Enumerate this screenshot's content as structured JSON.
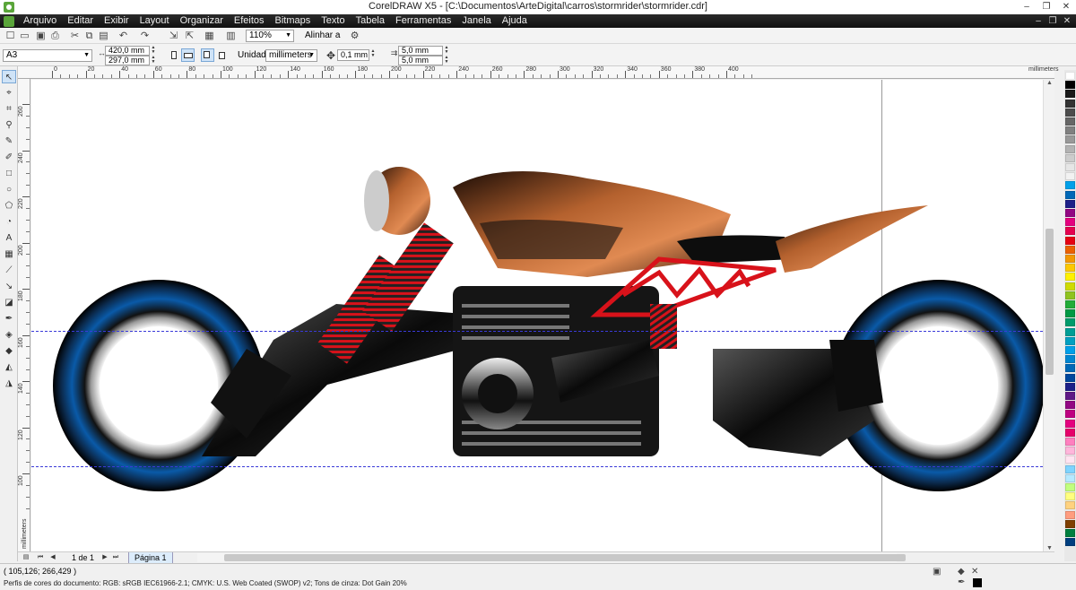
{
  "titlebar": {
    "title": "CorelDRAW X5 - [C:\\Documentos\\ArteDigital\\carros\\stormrider\\stormrider.cdr]",
    "minimize": "–",
    "restore": "❐",
    "close": "✕"
  },
  "menu": {
    "items": [
      "Arquivo",
      "Editar",
      "Exibir",
      "Layout",
      "Organizar",
      "Efeitos",
      "Bitmaps",
      "Texto",
      "Tabela",
      "Ferramentas",
      "Janela",
      "Ajuda"
    ],
    "doc_min": "–",
    "doc_restore": "❐",
    "doc_close": "✕"
  },
  "toolbar": {
    "zoom": "110%",
    "align_label": "Alinhar a"
  },
  "property_bar": {
    "page_size": "A3",
    "width": "420,0 mm",
    "height": "297,0 mm",
    "units_label": "Unidades:",
    "units": "millimeters",
    "nudge": "0,1 mm",
    "dup_x": "5,0 mm",
    "dup_y": "5,0 mm"
  },
  "ruler": {
    "units": "millimeters",
    "h_labels": [
      "0",
      "20",
      "40",
      "60",
      "80",
      "100",
      "120",
      "140",
      "160",
      "180",
      "200",
      "220",
      "240",
      "260",
      "280",
      "300",
      "320",
      "340",
      "360",
      "380",
      "400"
    ],
    "v_labels": [
      "260",
      "240",
      "220",
      "200",
      "180",
      "160",
      "140",
      "120",
      "100"
    ]
  },
  "page_nav": {
    "count": "1 de 1",
    "tab": "Página 1"
  },
  "status": {
    "coords": "( 105,126; 266,429 )",
    "profile": "Perfis de cores do documento: RGB: sRGB IEC61966-2.1; CMYK: U.S. Web Coated (SWOP) v2; Tons de cinza: Dot Gain 20%"
  },
  "colors": {
    "accent": "#5aa53a",
    "guide": "#3a3ad8",
    "selection": "#cfe3f7"
  },
  "palette": [
    "#ffffff",
    "#000000",
    "#1a1a1a",
    "#333333",
    "#4d4d4d",
    "#666666",
    "#808080",
    "#999999",
    "#b3b3b3",
    "#cccccc",
    "#e6e6e6",
    "#f2f2f2",
    "#00a0e9",
    "#0068b7",
    "#1d2088",
    "#920783",
    "#e4007f",
    "#e5004f",
    "#e60012",
    "#eb6100",
    "#f39800",
    "#fcc800",
    "#fff100",
    "#cfdb00",
    "#8fc31f",
    "#22ac38",
    "#009944",
    "#009b6b",
    "#009e96",
    "#00a0c1",
    "#00a0e9",
    "#0086d1",
    "#0068b7",
    "#00479d",
    "#1d2088",
    "#601986",
    "#920783",
    "#be0081",
    "#e4007f",
    "#e5006a",
    "#ff7fbf",
    "#ffb6db",
    "#ffe4f1",
    "#7fd4ff",
    "#b6e9ff",
    "#c1ff7f",
    "#ffff7f",
    "#ffd27f",
    "#ff9d7f",
    "#7f3f00",
    "#007f3f",
    "#003f7f"
  ]
}
